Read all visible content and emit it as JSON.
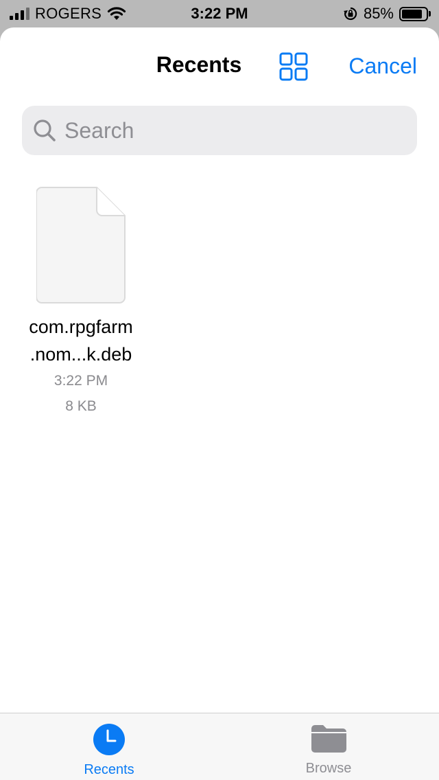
{
  "status_bar": {
    "carrier": "ROGERS",
    "time": "3:22 PM",
    "battery_percent": "85%",
    "battery_level": 0.85,
    "icons": [
      "signal-icon",
      "wifi-icon",
      "orientation-lock-icon",
      "battery-icon"
    ]
  },
  "header": {
    "title": "Recents",
    "grid_icon": "grid-view-icon",
    "cancel_label": "Cancel",
    "accent_color": "#0a7bf4"
  },
  "search": {
    "placeholder": "Search",
    "value": ""
  },
  "files": [
    {
      "name": "com.rpgfarm\n.nom...k.deb",
      "time": "3:22 PM",
      "size": "8 KB",
      "icon": "document-icon"
    }
  ],
  "tab_bar": {
    "tabs": [
      {
        "label": "Recents",
        "icon": "clock-icon",
        "selected": true
      },
      {
        "label": "Browse",
        "icon": "folder-icon",
        "selected": false
      }
    ]
  }
}
